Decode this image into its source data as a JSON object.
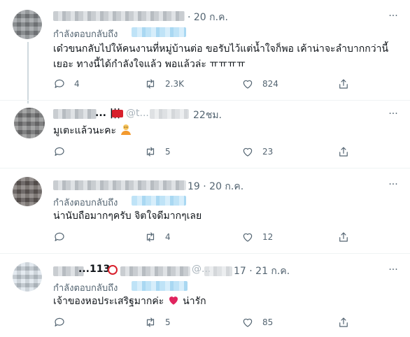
{
  "replying_to_label": "กำลังตอบกลับถึง",
  "more_label": "···",
  "tweets": [
    {
      "time": "· 20 ก.ค.",
      "body_lines": [
        "เด๋วขนกลับไปให้คนงานที่หมู่บ้านต่อ ขอรับไว้แต่น้ำใจก็พอ เค้าน่าจะลำบากกว่านี้",
        "เยอะ ทางนี้ได้กำลังใจแล้ว พอแล้วล่ะ ㅠㅠㅠㅠ"
      ],
      "replies": "4",
      "retweets": "2.3K",
      "likes": "824"
    },
    {
      "name_fragment": "... |||",
      "handle_fragment": "@t...",
      "time": "22ชม.",
      "body_lines": [
        "มูเตะแล้วนะคะ"
      ],
      "emoji": "person-emoji",
      "replies": "",
      "retweets": "5",
      "likes": "23"
    },
    {
      "time": "19 · 20 ก.ค.",
      "body_lines": [
        "น่านับถือมากๆครับ จิตใจดีมากๆเลย"
      ],
      "replies": "",
      "retweets": "4",
      "likes": "12"
    },
    {
      "name_fragment": "...113",
      "handle_fragment": "@...",
      "time": "17 · 21 ก.ค.",
      "body_lines": [
        "เจ้าของหอประเสริฐมากค่ะ",
        "น่ารัก"
      ],
      "emoji": "heart-emoji",
      "replies": "",
      "retweets": "5",
      "likes": "85"
    }
  ],
  "colors": {
    "secondary_text": "#536471",
    "primary_text": "#0f1419",
    "divider": "#eff3f4",
    "heart": "#e0245e"
  }
}
